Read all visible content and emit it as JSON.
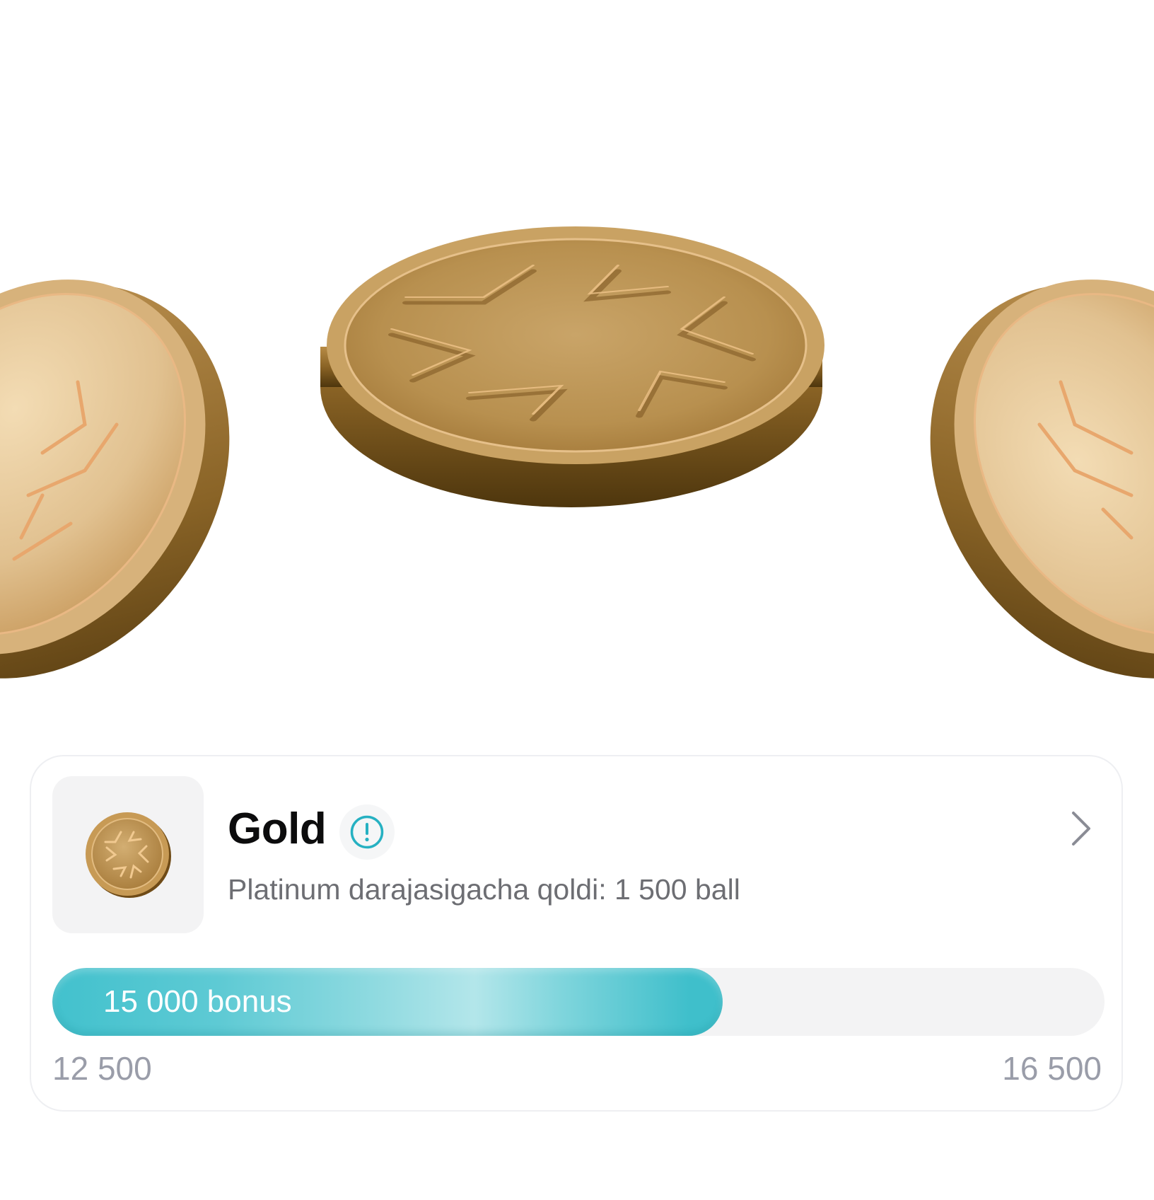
{
  "tier": {
    "name": "Gold",
    "remaining_text": "Platinum darajasigacha qoldi: 1 500 ball",
    "badge_icon": "gold-coin-icon",
    "info_icon": "info-circle-icon",
    "chevron_icon": "chevron-right-icon"
  },
  "progress": {
    "label": "15 000 bonus",
    "current": 15000,
    "min": 12500,
    "max": 16500,
    "min_label": "12 500",
    "max_label": "16 500",
    "fill_color": "#42c1cd"
  },
  "colors": {
    "accent": "#26b1c2",
    "gold": "#c79a55",
    "card_border": "#eeeff2"
  }
}
